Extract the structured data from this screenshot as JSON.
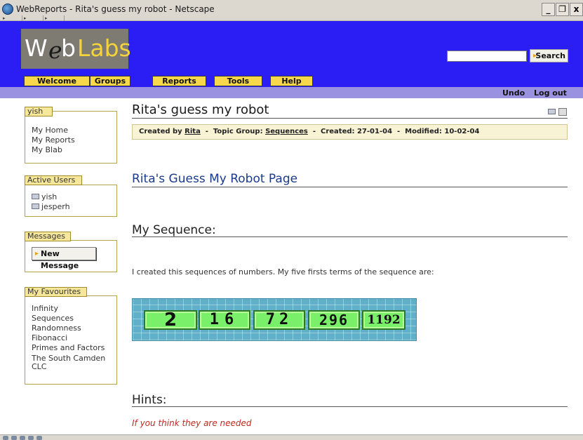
{
  "window": {
    "title": "WebReports - Rita's guess my robot - Netscape",
    "controls": [
      "_",
      "Б",
      "x"
    ]
  },
  "site": {
    "logo": {
      "w": "W",
      "e": "e",
      "b": "b",
      "labs": "Labs"
    },
    "search_label": "Search",
    "tabs": [
      "Welcome",
      "Groups",
      "Reports",
      "Tools",
      "Help"
    ],
    "undo": "Undo",
    "logout": "Log out"
  },
  "sidebar": {
    "user_box": {
      "title": "yish",
      "items": [
        "My Home",
        "My Reports",
        "My Blab"
      ]
    },
    "active_users": {
      "title": "Active Users",
      "users": [
        "yish",
        "jesperh"
      ]
    },
    "messages": {
      "title": "Messages",
      "button": "New Message"
    },
    "favourites": {
      "title": "My Favourites",
      "items": [
        "Infinity",
        "Sequences",
        "Randomness",
        "Fibonacci",
        "Primes and Factors",
        "The South Camden",
        "CLC"
      ]
    }
  },
  "main": {
    "title": "Rita's guess my robot",
    "meta": {
      "created_by_label": "Created by",
      "author": "Rita",
      "topic_label": "Topic Group:",
      "topic": "Sequences",
      "created_label": "Created: 27-01-04",
      "modified_label": "Modified: 10-02-04",
      "sep": "-"
    },
    "page_heading": "Rita's Guess My Robot Page",
    "sequence_heading": "My Sequence:",
    "intro": "I created this sequences of numbers. My five firsts terms of the sequence are:",
    "sequence_terms": [
      "2",
      "16",
      "72",
      "296",
      "1192"
    ],
    "hints_heading": "Hints:",
    "hint_text": "If you think they are needed"
  },
  "colors": {
    "header_blue": "#2a1ef5",
    "tab_yellow": "#f6d84a",
    "heading_blue": "#1a3a8c",
    "hint_red": "#c0281e"
  }
}
